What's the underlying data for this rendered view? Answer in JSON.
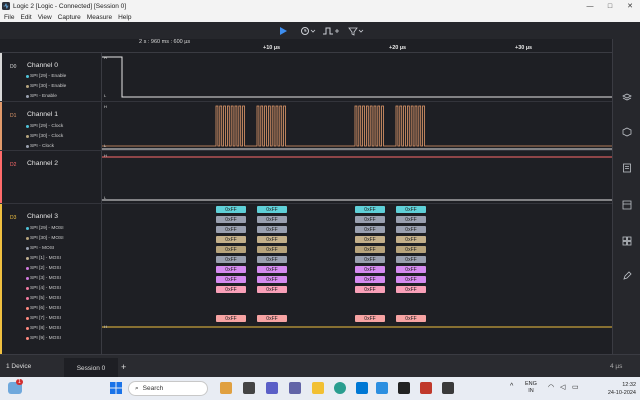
{
  "window": {
    "title": "Logic 2 [Logic - Connected] [Session 0]",
    "min": "—",
    "max": "□",
    "close": "✕"
  },
  "menu": [
    "File",
    "Edit",
    "View",
    "Capture",
    "Measure",
    "Help"
  ],
  "toolbar": {
    "icons": [
      "play-icon",
      "timer-icon",
      "trigger-icon",
      "filter-icon"
    ]
  },
  "ruler": {
    "timestamp": "2 s : 960 ms : 600 µs",
    "ticks": [
      "+10 µs",
      "+20 µs",
      "+30 µs"
    ]
  },
  "channels": [
    {
      "num": "D0",
      "name": "Channel 0",
      "color": "#d8d8d8",
      "subs": [
        {
          "label": "SPI [29] - Enable",
          "color": "#4fc3d9"
        },
        {
          "label": "SPI [30] - Enable",
          "color": "#b8a47c"
        },
        {
          "label": "SPI - Enable",
          "color": "#9aa0b0"
        }
      ]
    },
    {
      "num": "D1",
      "name": "Channel 1",
      "color": "#e29a6b",
      "subs": [
        {
          "label": "SPI [29] - Clock",
          "color": "#4fc3d9"
        },
        {
          "label": "SPI [30] - Clock",
          "color": "#b8a47c"
        },
        {
          "label": "SPI - Clock",
          "color": "#9aa0b0"
        }
      ]
    },
    {
      "num": "D2",
      "name": "Channel 2",
      "color": "#ff6b6b",
      "subs": []
    },
    {
      "num": "D3",
      "name": "Channel 3",
      "color": "#f0c040",
      "subs": [
        {
          "label": "SPI [29] - MOSI",
          "color": "#4fc3d9"
        },
        {
          "label": "SPI [30] - MOSI",
          "color": "#b8a47c"
        },
        {
          "label": "SPI - MOSI",
          "color": "#9aa0b0"
        },
        {
          "label": "SPI [1] - MOSI",
          "color": "#c0b090"
        },
        {
          "label": "SPI [2] - MOSI",
          "color": "#d17be0"
        },
        {
          "label": "SPI [3] - MOSI",
          "color": "#d17be0"
        },
        {
          "label": "SPI [4] - MOSI",
          "color": "#f27ca0"
        },
        {
          "label": "SPI [5] - MOSI",
          "color": "#f27ca0"
        },
        {
          "label": "SPI [6] - MOSI",
          "color": "#ff8a80"
        },
        {
          "label": "SPI [7] - MOSI",
          "color": "#ff8a80"
        },
        {
          "label": "SPI [8] - MOSI",
          "color": "#ff8a80"
        },
        {
          "label": "SPI [9] - MOSI",
          "color": "#ff8a80"
        }
      ]
    }
  ],
  "markers": {
    "high": "H",
    "low": "L"
  },
  "decoded": {
    "value": "0xFF",
    "rows": [
      {
        "color": "#5fd0d8"
      },
      {
        "color": "#9aa0b0"
      },
      {
        "color": "#9aa0b0"
      },
      {
        "color": "#c4b08a"
      },
      {
        "color": "#b8a47c"
      },
      {
        "color": "#9aa0b0"
      },
      {
        "color": "#d58af0"
      },
      {
        "color": "#d58af0"
      },
      {
        "color": "#f9a0b8"
      },
      {
        "color": "#f7a3a3"
      }
    ]
  },
  "status": {
    "device": "1 Device",
    "session": "Session 0",
    "plus": "+",
    "scale": "4 µs"
  },
  "taskbar": {
    "search": "Search",
    "lang1": "ENG",
    "lang2": "IN",
    "time": "12:32",
    "date": "24-10-2024",
    "badge": "1"
  }
}
